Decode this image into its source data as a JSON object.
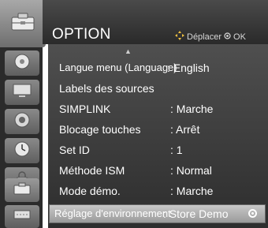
{
  "header": {
    "title": "OPTION",
    "hint_move": "Déplacer",
    "hint_ok": "OK"
  },
  "icons": [
    "option-tab-icon",
    "disc-icon",
    "monitor-icon",
    "speaker-icon",
    "clock-icon",
    "lock-icon",
    "option-tab-icon",
    "input-icon"
  ],
  "menu": {
    "items": [
      {
        "label": "Langue menu (Language)",
        "value": ": English"
      },
      {
        "label": "Labels des sources",
        "value": ""
      },
      {
        "label": "SIMPLINK",
        "value": ": Marche"
      },
      {
        "label": "Blocage touches",
        "value": ": Arrêt"
      },
      {
        "label": "Set ID",
        "value": ": 1"
      },
      {
        "label": "Méthode ISM",
        "value": ": Normal"
      },
      {
        "label": "Mode démo.",
        "value": ": Marche"
      },
      {
        "label": "Réglage d'environnement",
        "value": ": Store Demo"
      }
    ],
    "selected_index": 7
  },
  "colors": {
    "panel": "#3c3c3c",
    "selected": "#b0b0b0",
    "text": "#ffffff"
  }
}
